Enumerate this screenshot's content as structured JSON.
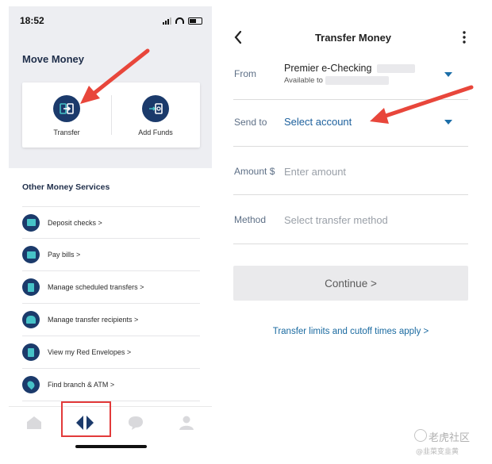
{
  "status_bar": {
    "time": "18:52"
  },
  "move_money": {
    "title": "Move Money",
    "actions": [
      {
        "label": "Transfer",
        "icon": "transfer-icon"
      },
      {
        "label": "Add Funds",
        "icon": "add-funds-icon"
      }
    ]
  },
  "other_services": {
    "title": "Other Money Services",
    "items": [
      {
        "label": "Deposit checks >",
        "icon": "deposit-checks-icon"
      },
      {
        "label": "Pay bills >",
        "icon": "pay-bills-icon"
      },
      {
        "label": "Manage scheduled transfers >",
        "icon": "scheduled-transfers-icon"
      },
      {
        "label": "Manage transfer recipients >",
        "icon": "recipients-icon"
      },
      {
        "label": "View my Red Envelopes >",
        "icon": "red-envelope-icon"
      },
      {
        "label": "Find branch & ATM >",
        "icon": "location-pin-icon"
      }
    ]
  },
  "tab_bar": {
    "tabs": [
      {
        "icon": "home-icon"
      },
      {
        "icon": "move-money-icon",
        "active": true
      },
      {
        "icon": "chat-icon"
      },
      {
        "icon": "profile-icon"
      }
    ]
  },
  "transfer_money": {
    "title": "Transfer Money",
    "from": {
      "label": "From",
      "account_name": "Premier e-Checking",
      "available_prefix": "Available to"
    },
    "send_to": {
      "label": "Send to",
      "value": "Select account"
    },
    "amount": {
      "label": "Amount $",
      "placeholder": "Enter amount"
    },
    "method": {
      "label": "Method",
      "placeholder": "Select transfer method"
    },
    "continue_label": "Continue >",
    "limits_link": "Transfer limits and cutoff times apply >"
  },
  "watermark": {
    "main": "老虎社区",
    "sub": "@韭菜变韭黄"
  },
  "colors": {
    "navy": "#1b3a6b",
    "teal_accent": "#46c2c7",
    "link_blue": "#1a6aa0",
    "arrow_red": "#e8463b",
    "highlight_red": "#e23a3a"
  }
}
